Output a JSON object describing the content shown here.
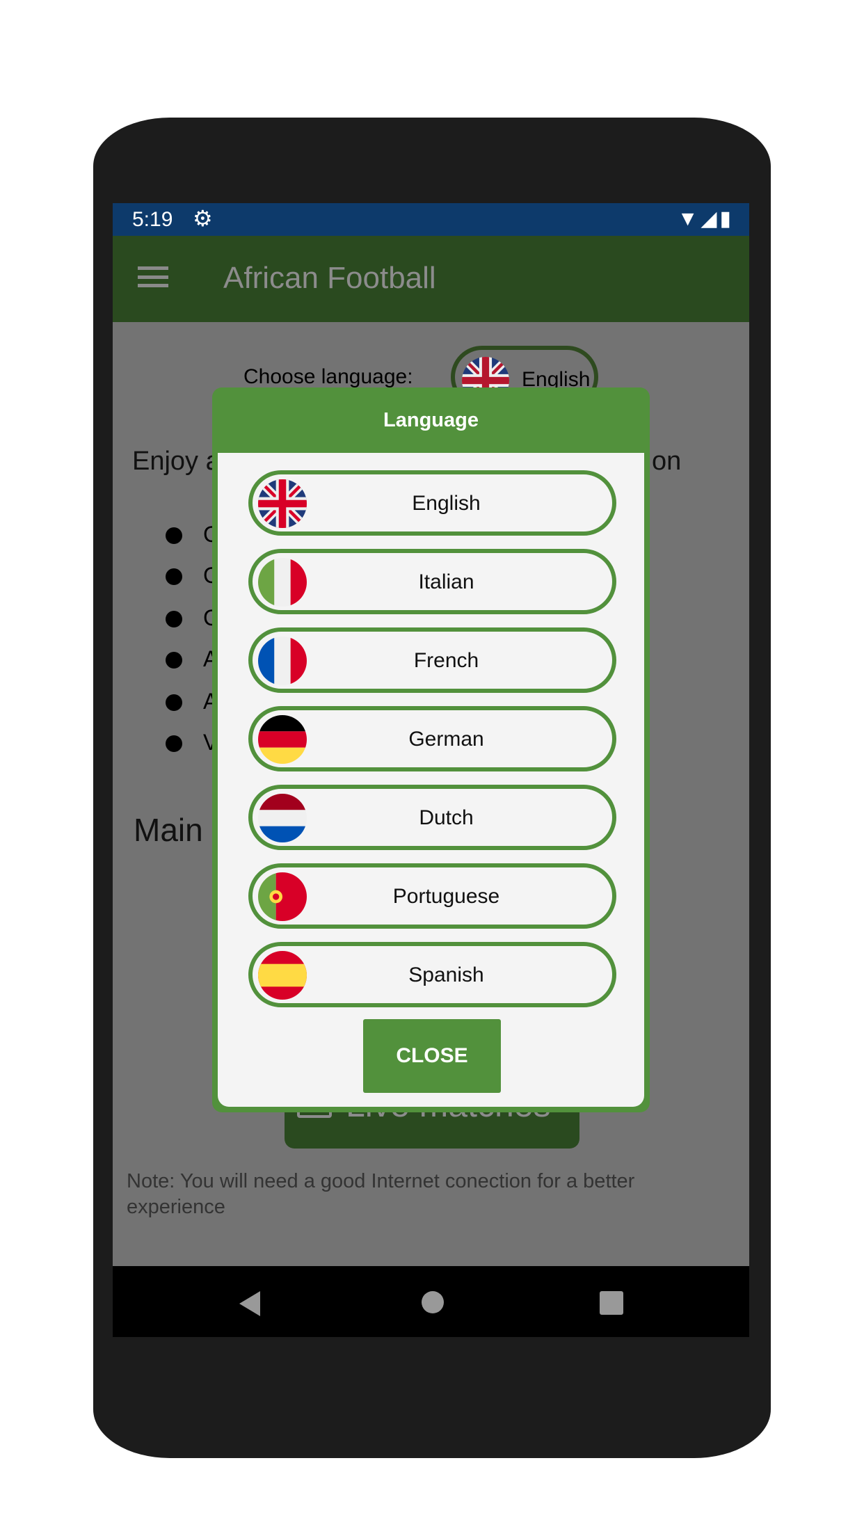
{
  "status_bar": {
    "time": "5:19",
    "icons": [
      "gear-icon",
      "wifi-icon",
      "signal-icon",
      "battery-icon"
    ]
  },
  "app_bar": {
    "title": "African Football"
  },
  "content": {
    "choose_language": "Choose language:",
    "current_language": "English",
    "enjoy_start": "Enjoy a",
    "enjoy_end": "on",
    "bullet_initials": [
      "C",
      "C",
      "C",
      "A",
      "A",
      "V"
    ],
    "main_heading": "Main",
    "live_matches": "Live matches",
    "note": "Note: You will need a good Internet conection for a better experience"
  },
  "dialog": {
    "title": "Language",
    "languages": [
      {
        "label": "English",
        "flag": "uk"
      },
      {
        "label": "Italian",
        "flag": "italy"
      },
      {
        "label": "French",
        "flag": "france"
      },
      {
        "label": "German",
        "flag": "germany"
      },
      {
        "label": "Dutch",
        "flag": "netherlands"
      },
      {
        "label": "Portuguese",
        "flag": "portugal"
      },
      {
        "label": "Spanish",
        "flag": "spain"
      }
    ],
    "close_label": "CLOSE"
  },
  "colors": {
    "dialog_green": "#52913c",
    "app_bar": "#2a4a1f",
    "status_bar": "#0d3a6b",
    "overlay": "#737373"
  }
}
